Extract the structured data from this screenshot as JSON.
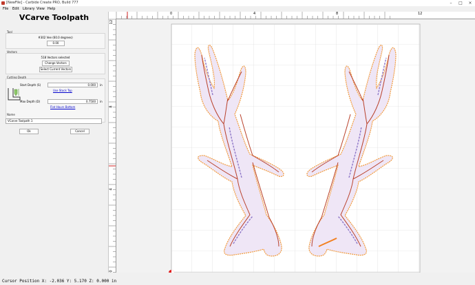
{
  "window": {
    "title": "[NewFile] - Carbide Create PRO, Build 777"
  },
  "menu": [
    "File",
    "Edit",
    "Library",
    "View",
    "Help"
  ],
  "panel": {
    "title": "VCarve Toolpath",
    "tool": {
      "section_label": "Tool",
      "name": "#302 Vee (60.0 degrees)",
      "button": "0.00"
    },
    "vectors": {
      "section_label": "Vectors",
      "summary": "518 Vectors selected",
      "change_button": "Change Vectors",
      "select_button": "Select Current Vectors"
    },
    "cutting_depth": {
      "section_label": "Cutting Depth",
      "start_label": "Start Depth (S)",
      "start_value": "0.000",
      "start_unit": "in",
      "stock_top_link": "Use Stock Top",
      "max_label": "Max Depth (D)",
      "max_value": "0.7500",
      "max_unit": "in",
      "max_link": "Flat Hours Bottom"
    },
    "name": {
      "section_label": "Name",
      "value": "VCarve Toolpath 1"
    },
    "ok_button": "Ok",
    "cancel_button": "Cancel"
  },
  "rulers": {
    "top_labels": [
      "0",
      "4",
      "8",
      "12"
    ],
    "left_labels": [
      "12",
      "8",
      "4",
      "0"
    ]
  },
  "status": {
    "text": "Cursor Position X: -2.036 Y: 5.170 Z: 0.000 in"
  },
  "colors": {
    "outline_orange": "#f29a3a",
    "inner_red": "#b8402a",
    "fill_purple": "#8f78c8",
    "origin_red": "#e02020",
    "grid": "#d6d6d6"
  }
}
